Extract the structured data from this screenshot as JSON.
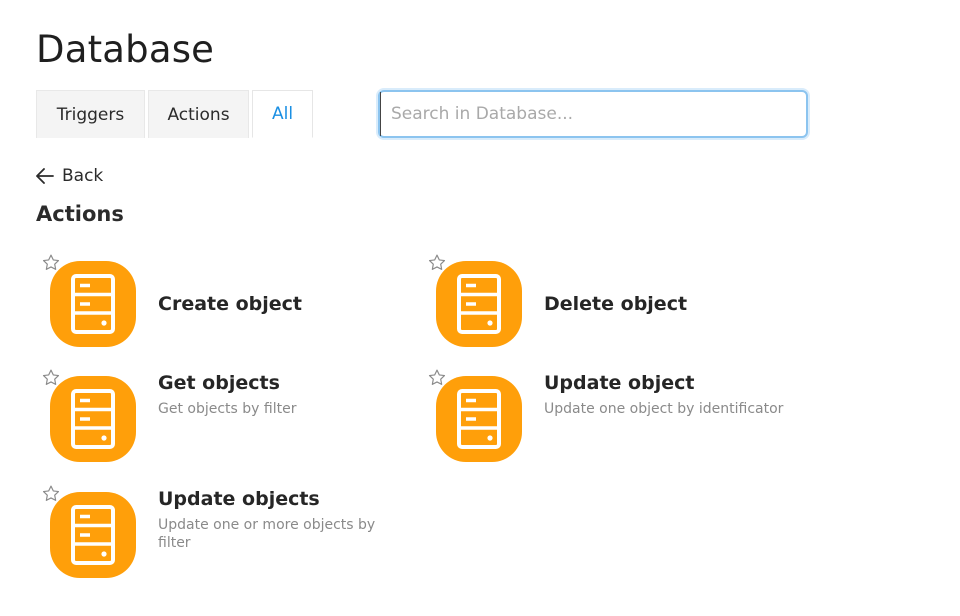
{
  "header": {
    "title": "Database"
  },
  "tabs": [
    {
      "label": "Triggers",
      "active": false
    },
    {
      "label": "Actions",
      "active": false
    },
    {
      "label": "All",
      "active": true
    }
  ],
  "search": {
    "placeholder": "Search in Database...",
    "value": ""
  },
  "nav": {
    "back_label": "Back"
  },
  "section": {
    "title": "Actions"
  },
  "icons": {
    "star": "star-outline-icon",
    "app": "database-server-icon",
    "back": "arrow-left-icon"
  },
  "colors": {
    "accent": "#1a8fe3",
    "icon_bg": "#ff9f0a",
    "search_border": "#8cc4ef"
  },
  "actions": [
    {
      "name": "Create object",
      "description": ""
    },
    {
      "name": "Delete object",
      "description": ""
    },
    {
      "name": "Get objects",
      "description": "Get objects by filter"
    },
    {
      "name": "Update object",
      "description": "Update one object by identificator"
    },
    {
      "name": "Update objects",
      "description": "Update one or more objects by filter"
    }
  ]
}
